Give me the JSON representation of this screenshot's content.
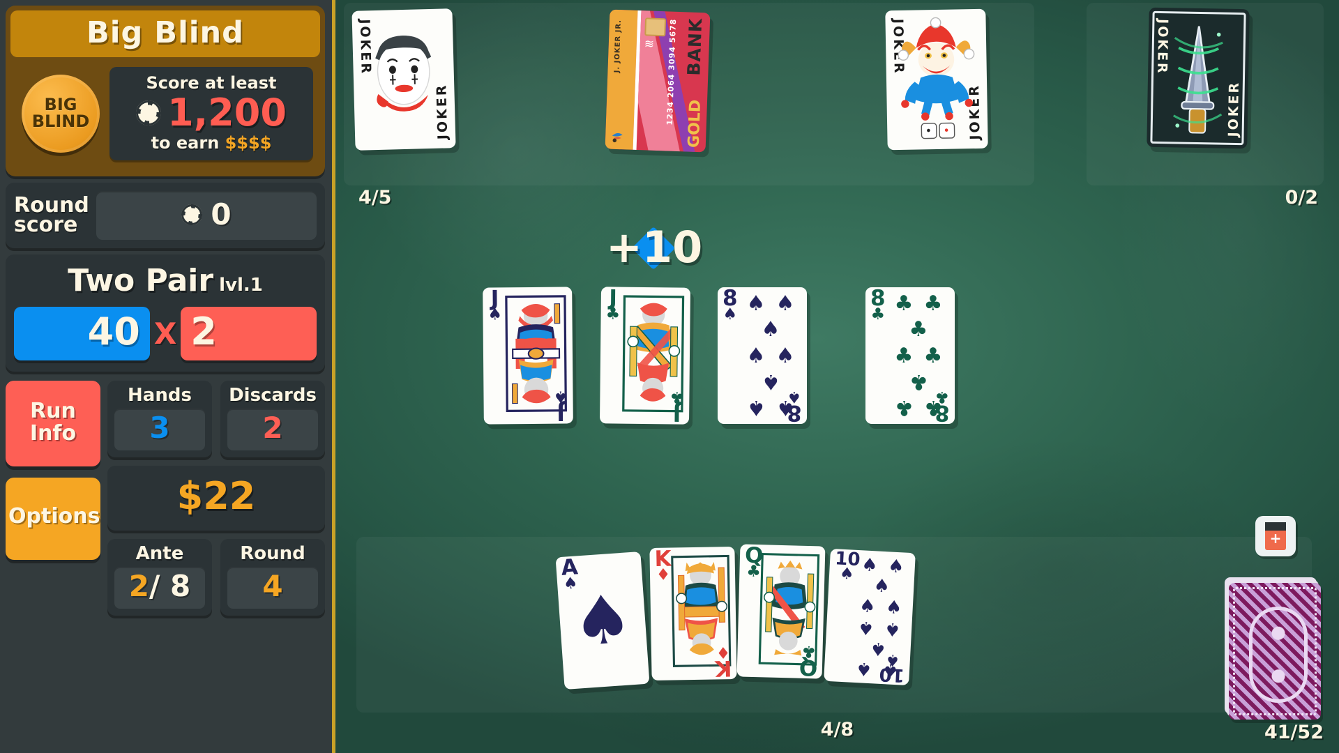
{
  "sidebar": {
    "blind": {
      "title": "Big Blind",
      "chip_line1": "BIG",
      "chip_line2": "BLIND",
      "requirement_top": "Score at least",
      "requirement_score": "1,200",
      "requirement_bottom": "to earn",
      "reward": "$$$$",
      "chip_icon": "poker-chip-icon"
    },
    "round_score": {
      "label_line1": "Round",
      "label_line2": "score",
      "value": "0",
      "chip_icon": "poker-chip-icon"
    },
    "hand": {
      "name": "Two Pair",
      "level": "lvl.1",
      "chips": "40",
      "times_symbol": "X",
      "mult": "2",
      "chips_color": "#0a8ff0",
      "mult_color": "#fe5f55"
    },
    "buttons": {
      "run_info": "Run\nInfo",
      "run_info_line1": "Run",
      "run_info_line2": "Info",
      "options": "Options"
    },
    "stats": {
      "hands": {
        "label": "Hands",
        "value": "3"
      },
      "discards": {
        "label": "Discards",
        "value": "2"
      },
      "money": {
        "value": "$22"
      },
      "ante": {
        "label": "Ante",
        "value": "2",
        "max": "/ 8"
      },
      "round": {
        "label": "Round",
        "value": "4"
      }
    }
  },
  "table": {
    "joker_slots": "4/5",
    "consumable_slots": "0/2",
    "hand_slots": "4/8",
    "deck_count": "41/52",
    "score_popup": "+10",
    "booster_icon": "booster-pack-icon",
    "jokers": [
      {
        "name": "Joker",
        "label": "JOKER",
        "art": "mime-face"
      },
      {
        "name": "Credit Card",
        "bank_text": "BANK",
        "gold_text": "GOLD",
        "number": "1234 2064 3094 5678",
        "holder": "J. JOKER JR.",
        "art": "credit-card"
      },
      {
        "name": "Jolly Joker",
        "label": "JOKER",
        "art": "jester-with-dice"
      },
      {
        "name": "Obelisk",
        "label": "JOKER",
        "art": "glowing-dagger"
      }
    ],
    "played_cards": [
      {
        "rank": "J",
        "suit": "spades",
        "suit_glyph": "♠",
        "color": "#25245e"
      },
      {
        "rank": "J",
        "suit": "clubs",
        "suit_glyph": "♣",
        "color": "#13604a"
      },
      {
        "rank": "8",
        "suit": "spades",
        "suit_glyph": "♠",
        "color": "#25245e"
      },
      {
        "rank": "8",
        "suit": "clubs",
        "suit_glyph": "♣",
        "color": "#13604a"
      }
    ],
    "hand_cards": [
      {
        "rank": "A",
        "suit": "spades",
        "suit_glyph": "♠",
        "color": "#25245e"
      },
      {
        "rank": "K",
        "suit": "diamonds",
        "suit_glyph": "♦",
        "color": "#e0403a"
      },
      {
        "rank": "Q",
        "suit": "clubs",
        "suit_glyph": "♣",
        "color": "#13604a"
      },
      {
        "rank": "10",
        "suit": "spades",
        "suit_glyph": "♠",
        "color": "#25245e"
      }
    ]
  }
}
